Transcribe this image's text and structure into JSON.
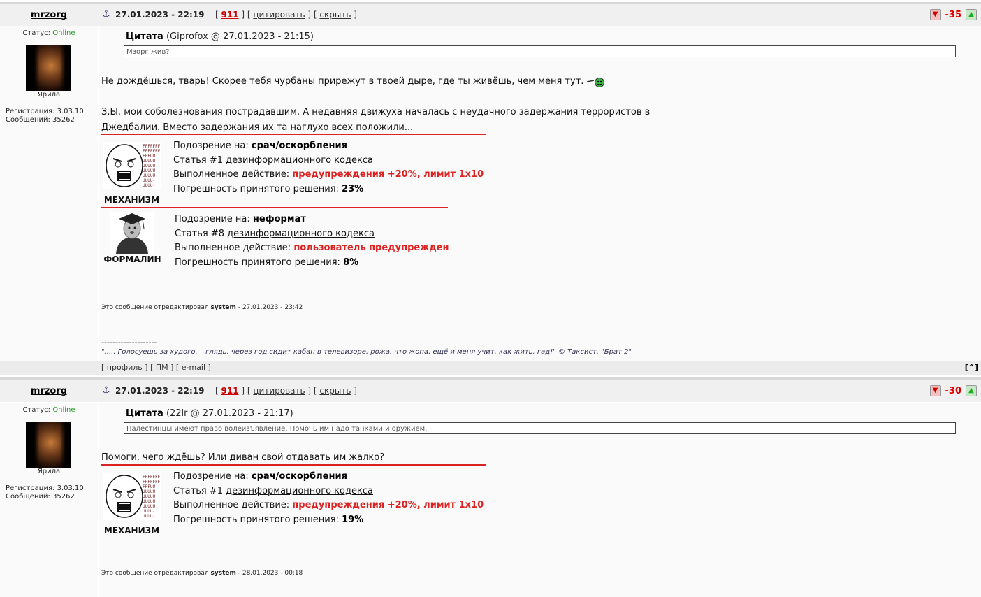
{
  "posts": [
    {
      "nick": "mrzorg",
      "anchor_icon": "anchor-icon",
      "date": "27.01.2023 - 22:19",
      "post_number": "911",
      "quote_link": "цитировать",
      "hide_link": "скрыть",
      "score": "-35",
      "status_label": "Статус:",
      "status_value": "Online",
      "rank": "Ярила",
      "registration": "Регистрация: 3.03.10",
      "messages": "Сообщений: 35262",
      "quote_title": "Цитата",
      "quote_meta": "(Giprofox @ 27.01.2023 - 21:15)",
      "quote_text": "Мзорг жив?",
      "text1": "Не дождёшься, тварь! Скорее тебя чурбаны прирежут в твоей дыре, где ты живёшь, чем меня тут.",
      "text2a": "З.Ы. мои соболезнования пострадавшим. А недавняя движуха началась с неудачного задержания террористов в",
      "text2b": "Джедбалии. Вместо задержания их та наглухо всех положили...",
      "mods": [
        {
          "name": "МЕХАНИЗМ",
          "suspicion_label": "Подозрение на:",
          "suspicion": "срач/оскорбления",
          "article_prefix": "Статья #1",
          "article_link": "дезинформационного кодекса",
          "action_label": "Выполненное действие:",
          "action": "предупреждения +20%, лимит 1x10",
          "error_label": "Погрешность принятого решения:",
          "error": "23%"
        },
        {
          "name": "ФОРМАЛИН",
          "suspicion_label": "Подозрение на:",
          "suspicion": "неформат",
          "article_prefix": "Статья #8",
          "article_link": "дезинформационного кодекса",
          "action_label": "Выполненное действие:",
          "action": "пользователь предупрежден",
          "error_label": "Погрешность принятого решения:",
          "error": "8%"
        }
      ],
      "edited_prefix": "Это сообщение отредактировал",
      "edited_by": "system",
      "edited_date": "- 27.01.2023 - 23:42",
      "sig_line": "--------------------",
      "sig_text": "\"..... Голосуешь за худого, – глядь, через год сидит кабан в телевизоре, рожа, что жопа, ещё и меня учит, как жить, гад!\" © Таксист, \"Брат 2\"",
      "footer_profile": "профиль",
      "footer_pm": "ПМ",
      "footer_email": "e-mail",
      "footer_up": "[^]"
    },
    {
      "nick": "mrzorg",
      "date": "27.01.2023 - 22:19",
      "post_number": "911",
      "quote_link": "цитировать",
      "hide_link": "скрыть",
      "score": "-30",
      "status_label": "Статус:",
      "status_value": "Online",
      "rank": "Ярила",
      "registration": "Регистрация: 3.03.10",
      "messages": "Сообщений: 35262",
      "quote_title": "Цитата",
      "quote_meta": "(22lr @ 27.01.2023 - 21:17)",
      "quote_text": "Палестинцы имеют право волеизъявление. Помочь им надо танками и оружием.",
      "text1": "Помоги, чего ждёшь? Или диван свой отдавать им жалко?",
      "mods": [
        {
          "name": "МЕХАНИЗМ",
          "suspicion_label": "Подозрение на:",
          "suspicion": "срач/оскорбления",
          "article_prefix": "Статья #1",
          "article_link": "дезинформационного кодекса",
          "action_label": "Выполненное действие:",
          "action": "предупреждения +20%, лимит 1x10",
          "error_label": "Погрешность принятого решения:",
          "error": "19%"
        }
      ],
      "edited_prefix": "Это сообщение отредактировал",
      "edited_by": "system",
      "edited_date": "- 28.01.2023 - 00:18"
    }
  ],
  "colors": {
    "score": "#dd0000",
    "online": "#2a9a2a",
    "action": "#dd2222"
  }
}
